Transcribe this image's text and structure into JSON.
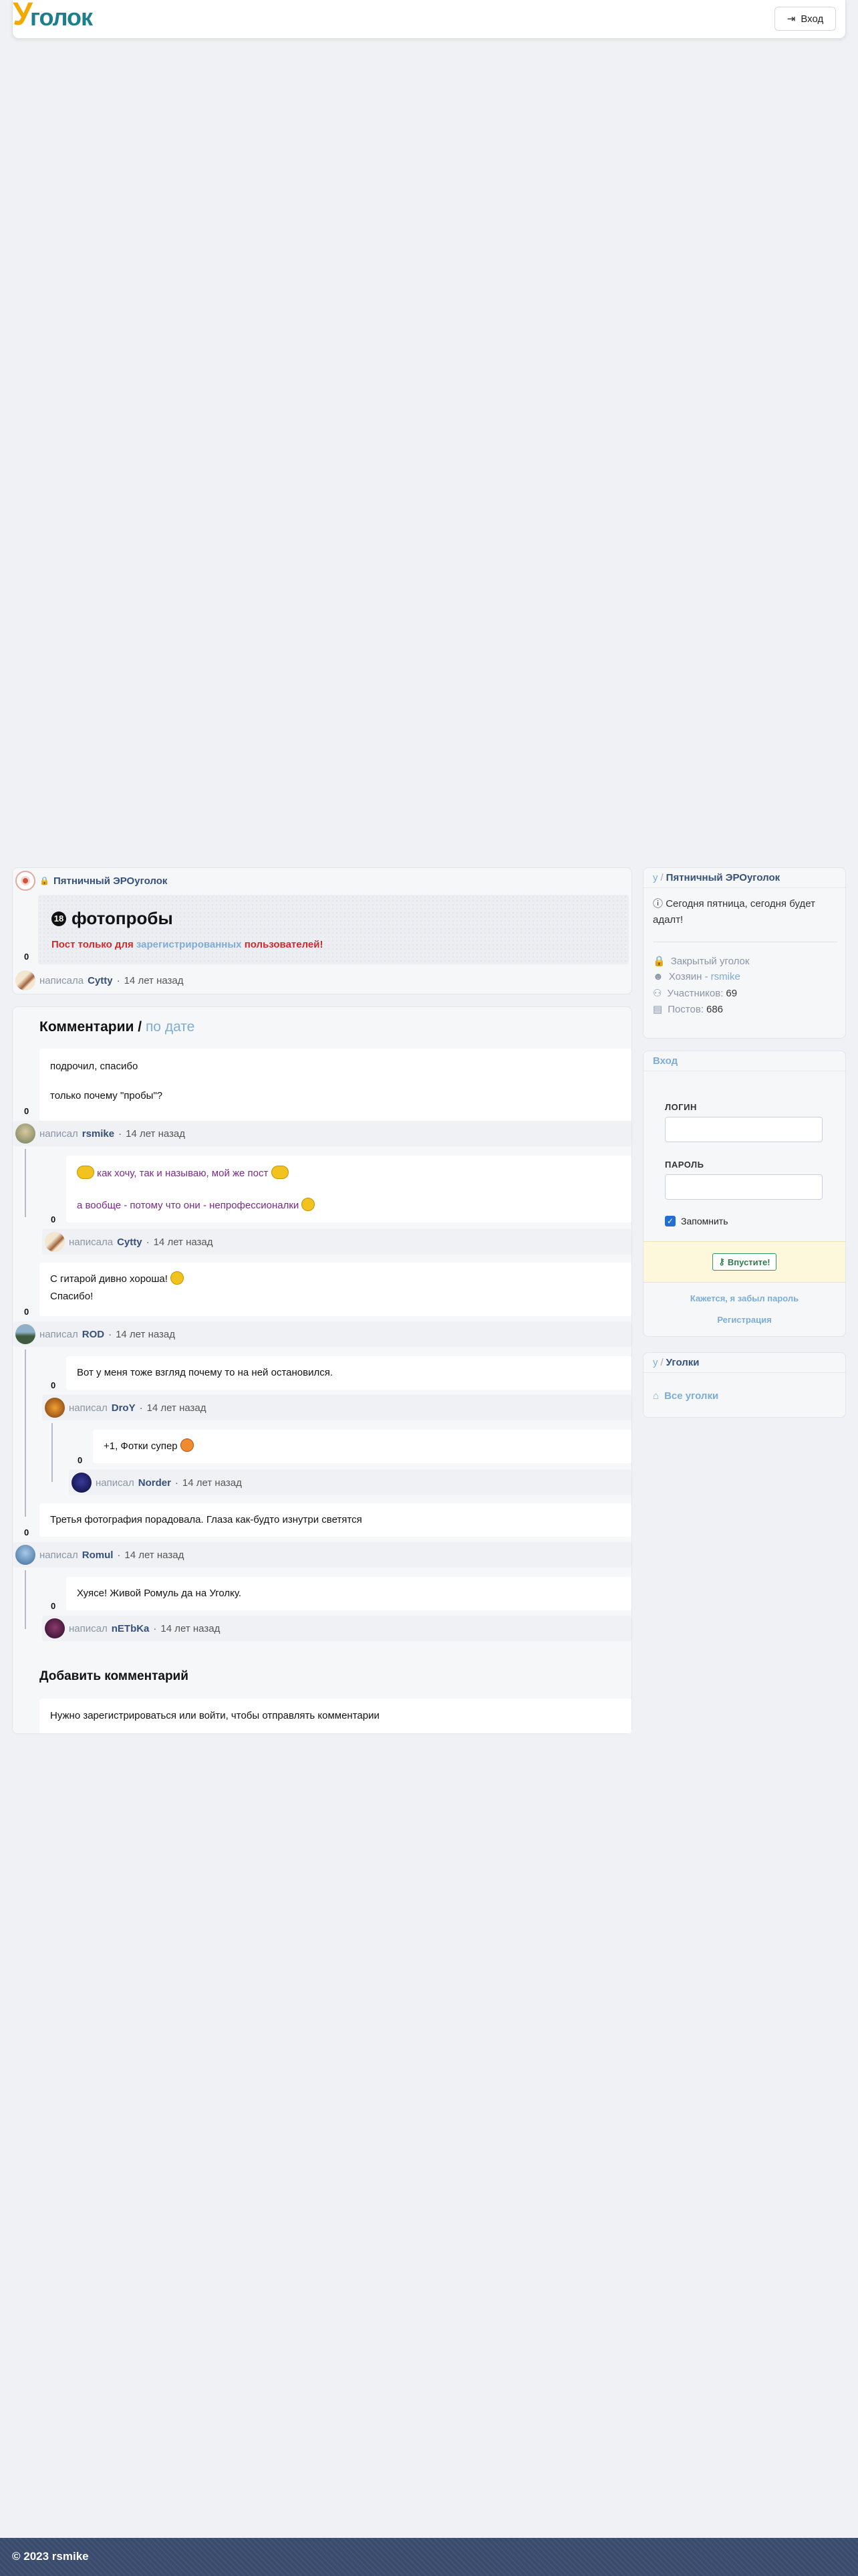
{
  "header": {
    "logo_initial": "У",
    "logo_rest": "голок",
    "login_label": "Вход"
  },
  "post": {
    "corner_name": "Пятничный ЭРОуголок",
    "title": "фотопробы",
    "warning_prefix": "Пост только для",
    "warning_link": "зарегистрированных",
    "warning_suffix": "пользователей!",
    "votes": "0",
    "written_by": "написала",
    "author": "Cytty",
    "time": "14 лет назад"
  },
  "comments": {
    "heading": "Комментарии",
    "sort_label": "по дате",
    "items": [
      {
        "line1": "подрочил, спасибо",
        "line2": "только почему \"пробы\"?",
        "votes": "0",
        "written_by": "написал",
        "author": "rsmike",
        "time": "14 лет назад"
      },
      {
        "line1": "как хочу, так и называю, мой же пост",
        "line2": "а вообще - потому что они - непрофессионалки",
        "votes": "0",
        "written_by": "написала",
        "author": "Cytty",
        "time": "14 лет назад"
      },
      {
        "line1": "С гитарой дивно хороша!",
        "line2": "Спасибо!",
        "votes": "0",
        "written_by": "написал",
        "author": "ROD",
        "time": "14 лет назад"
      },
      {
        "line1": "Вот у меня тоже взгляд почему то на ней остановился.",
        "votes": "0",
        "written_by": "написал",
        "author": "DroY",
        "time": "14 лет назад"
      },
      {
        "line1": "+1, Фотки супер",
        "votes": "0",
        "written_by": "написал",
        "author": "Norder",
        "time": "14 лет назад"
      },
      {
        "line1": "Третья фотография порадовала. Глаза как-будто изнутри светятся",
        "votes": "0",
        "written_by": "написал",
        "author": "Romul",
        "time": "14 лет назад"
      },
      {
        "line1": "Хуясе! Живой Ромуль да на Уголку.",
        "votes": "0",
        "written_by": "написал",
        "author": "nETbKa",
        "time": "14 лет назад"
      }
    ],
    "add_heading": "Добавить комментарий",
    "add_notice": "Нужно зарегистрироваться или войти, чтобы отправлять комментарии"
  },
  "sidebar": {
    "corner": {
      "prefix": "у",
      "title": "Пятничный ЭРОуголок",
      "description": "Сегодня пятница, сегодня будет адалт!",
      "closed": "Закрытый уголок",
      "owner_label": "Хозяин -",
      "owner": "rsmike",
      "members_label": "Участников:",
      "members": "69",
      "posts_label": "Постов:",
      "posts": "686"
    },
    "login": {
      "title": "Вход",
      "login_label": "ЛОГИН",
      "password_label": "ПАРОЛЬ",
      "remember_label": "Запомнить",
      "submit_label": "Впустите!",
      "forgot_label": "Кажется, я забыл пароль",
      "register_label": "Регистрация"
    },
    "corners": {
      "prefix": "у",
      "title": "Уголки",
      "all_label": "Все уголки"
    }
  },
  "footer": {
    "text": "© 2023 rsmike"
  },
  "colors": {
    "accent": "#35507b",
    "link": "#7dadd6",
    "logo_orange": "#f2a900",
    "logo_teal": "#1d7f8e",
    "warning": "#d02a2a",
    "footer": "#3a4b6e"
  }
}
